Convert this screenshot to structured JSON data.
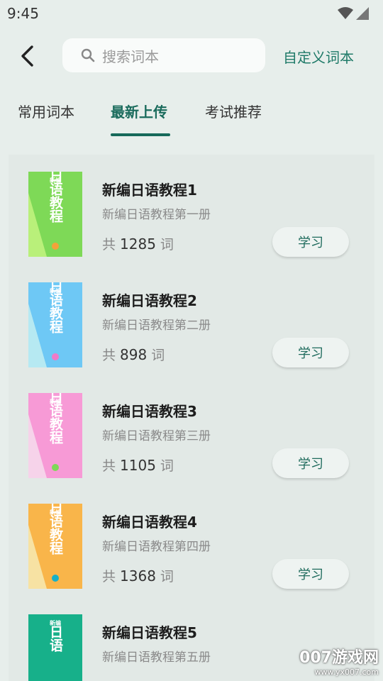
{
  "status": {
    "time": "9:45"
  },
  "header": {
    "search_placeholder": "搜索词本",
    "custom_link": "自定义词本"
  },
  "tabs": [
    {
      "label": "常用词本",
      "active": false
    },
    {
      "label": "最新上传",
      "active": true
    },
    {
      "label": "考试推荐",
      "active": false
    }
  ],
  "books": [
    {
      "title": "新编日语教程1",
      "subtitle": "新编日语教程第一册",
      "count_prefix": "共",
      "count": "1285",
      "count_unit": "词",
      "button": "学习",
      "cover_color": "#7ed957",
      "cover_accent": "#b9f07a",
      "badge": "①",
      "cover_label": "新编",
      "cover_text": "日语教程"
    },
    {
      "title": "新编日语教程2",
      "subtitle": "新编日语教程第二册",
      "count_prefix": "共",
      "count": "898",
      "count_unit": "词",
      "button": "学习",
      "cover_color": "#6ec8f5",
      "cover_accent": "#b6e9f2",
      "badge": "②",
      "cover_label": "新编",
      "cover_text": "日语教程"
    },
    {
      "title": "新编日语教程3",
      "subtitle": "新编日语教程第三册",
      "count_prefix": "共",
      "count": "1105",
      "count_unit": "词",
      "button": "学习",
      "cover_color": "#f79ad6",
      "cover_accent": "#f6d3ea",
      "badge": "③",
      "cover_label": "新编",
      "cover_text": "日语教程"
    },
    {
      "title": "新编日语教程4",
      "subtitle": "新编日语教程第四册",
      "count_prefix": "共",
      "count": "1368",
      "count_unit": "词",
      "button": "学习",
      "cover_color": "#f9b54a",
      "cover_accent": "#f7e2a3",
      "badge": "④",
      "cover_label": "新编",
      "cover_text": "日语教程"
    },
    {
      "title": "新编日语教程5",
      "subtitle": "新编日语教程第五册",
      "count_prefix": "",
      "count": "",
      "count_unit": "",
      "button": "",
      "cover_color": "#17b08a",
      "cover_accent": "#17b08a",
      "badge": "",
      "cover_label": "新编",
      "cover_text": "日语"
    }
  ],
  "watermark": {
    "main": "007游戏网",
    "url": "www.yx007.com"
  }
}
